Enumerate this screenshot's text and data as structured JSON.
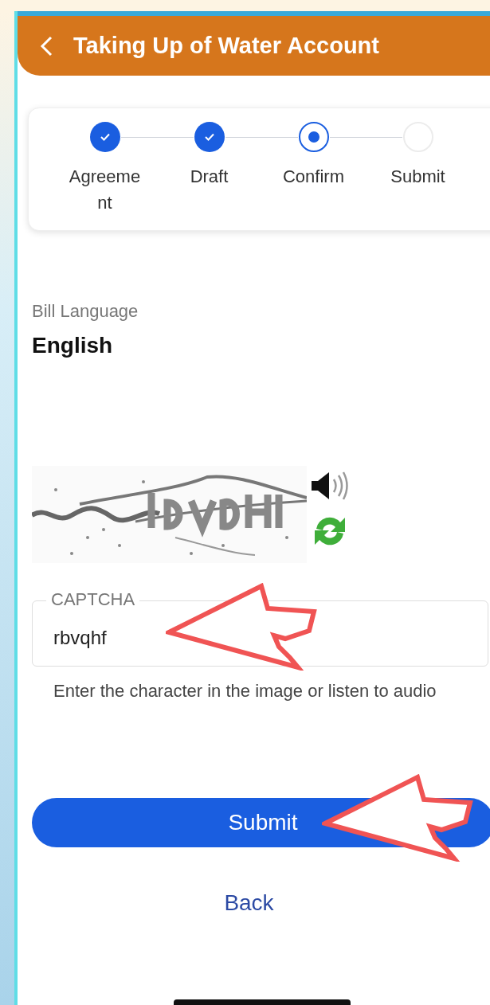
{
  "header": {
    "title": "Taking Up of Water Account"
  },
  "steps": [
    {
      "label": "Agreement",
      "kind": "done"
    },
    {
      "label": "Draft",
      "kind": "done"
    },
    {
      "label": "Confirm",
      "kind": "current"
    },
    {
      "label": "Submit",
      "kind": "pending"
    }
  ],
  "fields": [
    {
      "label": "Bill Language",
      "value": "English"
    }
  ],
  "captcha": {
    "kind": "picture",
    "input": {
      "label": "CAPTCHA",
      "value": "rbvqhf"
    },
    "hint": "Enter the character in the image or listen to audio"
  },
  "buttons": [
    {
      "label": "Submit",
      "kind": "primary"
    },
    {
      "label": "Back",
      "kind": "link"
    }
  ]
}
